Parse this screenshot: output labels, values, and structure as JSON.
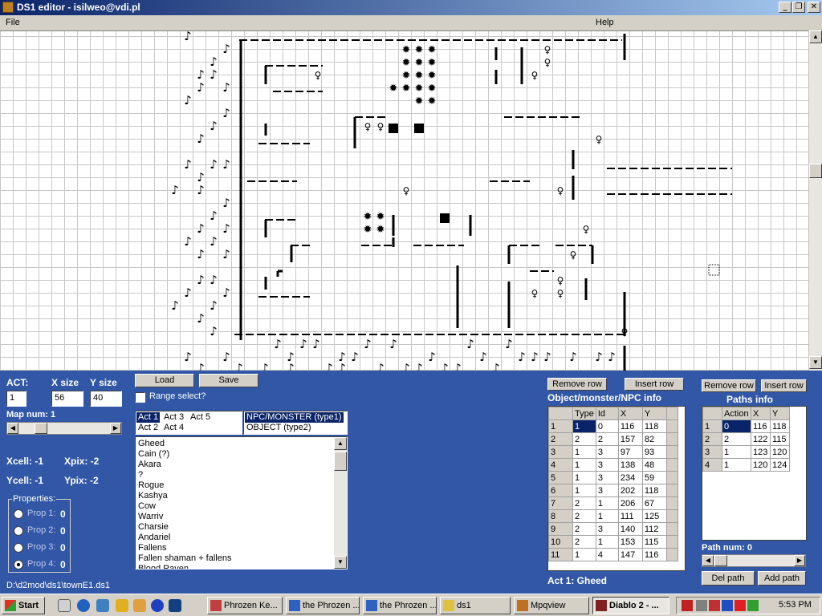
{
  "window": {
    "title": "DS1 editor - isilweo@vdi.pl",
    "menu": {
      "file": "File",
      "help": "Help"
    },
    "controls": {
      "minimize": "_",
      "maximize": "❐",
      "close": "✕"
    }
  },
  "left": {
    "act_label": "ACT:",
    "act_value": "1",
    "xsize_label": "X size",
    "xsize_value": "56",
    "ysize_label": "Y size",
    "ysize_value": "40",
    "map_num": "Map num: 1",
    "xcell": "Xcell: -1",
    "xpix": "Xpix: -2",
    "ycell": "Ycell: -1",
    "ypix": "Ypix: -2",
    "properties": {
      "legend": "Properties:",
      "items": [
        {
          "label": "Prop 1:",
          "value": "0",
          "selected": false
        },
        {
          "label": "Prop 2:",
          "value": "0",
          "selected": false
        },
        {
          "label": "Prop 3:",
          "value": "0",
          "selected": false
        },
        {
          "label": "Prop 4:",
          "value": "0",
          "selected": true
        }
      ]
    },
    "file_path": "D:\\d2mod\\ds1\\townE1.ds1"
  },
  "middle": {
    "load": "Load",
    "save": "Save",
    "range_select": "Range select?",
    "acts": [
      "Act 1",
      "Act 3",
      "Act 5",
      "Act 2",
      "Act 4"
    ],
    "types": [
      "NPC/MONSTER (type1)",
      "OBJECT (type2)"
    ],
    "monsters": [
      "Gheed",
      "Cain (?)",
      "Akara",
      "?",
      "Rogue",
      "Kashya",
      "Cow",
      "Warriv",
      "Charsie",
      "Andariel",
      "Fallens",
      "Fallen shaman + fallens",
      "Blood Raven"
    ]
  },
  "objects": {
    "remove_row": "Remove row",
    "insert_row": "Insert row",
    "title": "Object/monster/NPC info",
    "headers": [
      "Type",
      "Id",
      "X",
      "Y"
    ],
    "rows": [
      [
        "1",
        "1",
        "0",
        "116",
        "118"
      ],
      [
        "2",
        "2",
        "2",
        "157",
        "82"
      ],
      [
        "3",
        "1",
        "3",
        "97",
        "93"
      ],
      [
        "4",
        "1",
        "3",
        "138",
        "48"
      ],
      [
        "5",
        "1",
        "3",
        "234",
        "59"
      ],
      [
        "6",
        "1",
        "3",
        "202",
        "118"
      ],
      [
        "7",
        "2",
        "1",
        "206",
        "67"
      ],
      [
        "8",
        "2",
        "1",
        "111",
        "125"
      ],
      [
        "9",
        "2",
        "3",
        "140",
        "112"
      ],
      [
        "10",
        "2",
        "1",
        "153",
        "115"
      ],
      [
        "11",
        "1",
        "4",
        "147",
        "116"
      ]
    ],
    "status": "Act 1: Gheed"
  },
  "paths": {
    "remove_row": "Remove row",
    "insert_row": "Insert row",
    "title": "Paths info",
    "headers": [
      "Action",
      "X",
      "Y"
    ],
    "rows": [
      [
        "1",
        "0",
        "116",
        "118"
      ],
      [
        "2",
        "2",
        "122",
        "115"
      ],
      [
        "3",
        "1",
        "123",
        "120"
      ],
      [
        "4",
        "1",
        "120",
        "124"
      ]
    ],
    "path_num": "Path num: 0",
    "del_path": "Del path",
    "add_path": "Add path"
  },
  "taskbar": {
    "start": "Start",
    "tasks": [
      "Phrozen Ke...",
      "the Phrozen ...",
      "the Phrozen ...",
      "ds1",
      "Mpqview",
      "Diablo 2 - ..."
    ],
    "active_task": 5,
    "clock": "5:53 PM"
  },
  "colors": {
    "panel": "#3157a6",
    "title_start": "#0a246a",
    "title_end": "#a6caf0",
    "face": "#d4d0c8"
  }
}
